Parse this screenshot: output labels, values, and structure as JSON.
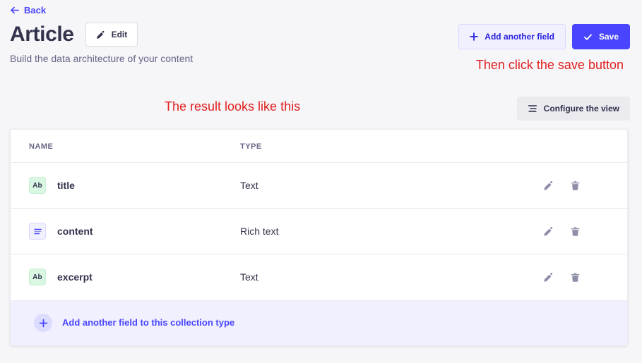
{
  "header": {
    "back_label": "Back",
    "title": "Article",
    "edit_label": "Edit",
    "subtitle": "Build the data architecture of your content",
    "add_field_label": "Add another field",
    "save_label": "Save"
  },
  "annotations": {
    "save_hint": "Then click the save button",
    "result_hint": "The result looks like this",
    "color": "#e02020"
  },
  "toolbar": {
    "configure_label": "Configure the view"
  },
  "table": {
    "columns": [
      "NAME",
      "TYPE",
      ""
    ],
    "rows": [
      {
        "badge": "Ab",
        "badge_kind": "text",
        "name": "title",
        "type": "Text",
        "edit_icon": "pencil-icon",
        "delete_icon": "trash-icon"
      },
      {
        "badge": "",
        "badge_kind": "richtext",
        "name": "content",
        "type": "Rich text",
        "edit_icon": "pencil-icon",
        "delete_icon": "trash-icon"
      },
      {
        "badge": "Ab",
        "badge_kind": "text",
        "name": "excerpt",
        "type": "Text",
        "edit_icon": "pencil-icon",
        "delete_icon": "trash-icon"
      }
    ]
  },
  "footer": {
    "add_label": "Add another field to this collection type"
  },
  "colors": {
    "primary": "#4945ff",
    "primary_soft": "#f0f0ff",
    "text_dark": "#32324d",
    "text_muted": "#666687",
    "page_bg": "#f6f6f9",
    "badge_green": "#d9f7e3"
  }
}
